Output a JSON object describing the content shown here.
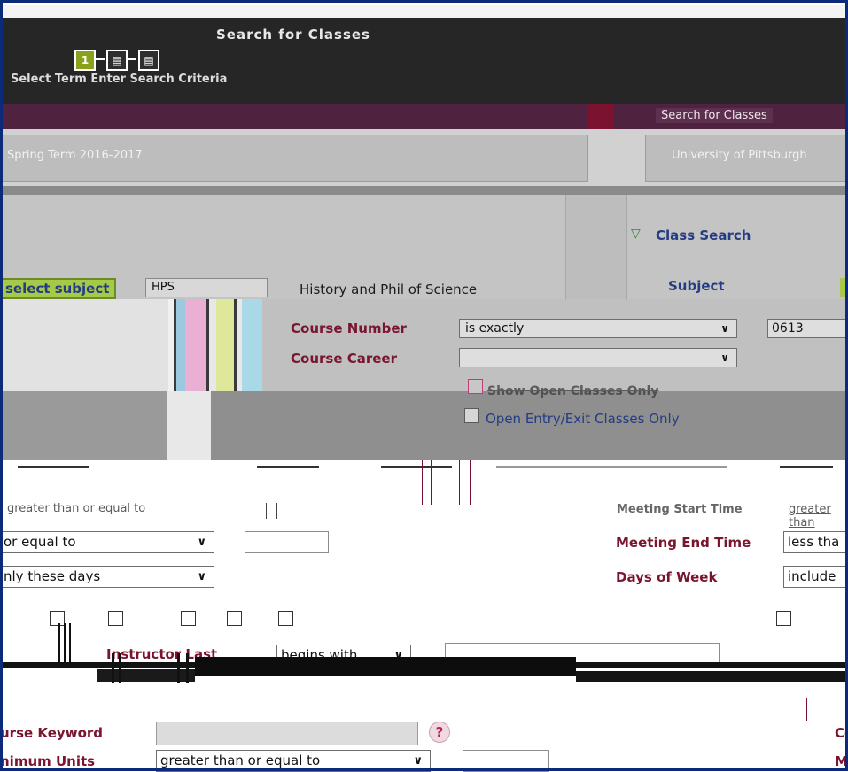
{
  "header": {
    "page_title": "Search for Classes",
    "steps": [
      "1",
      "",
      ""
    ],
    "wizard_label": "Select Term  Enter Search Criteria"
  },
  "tabs": {
    "active": "Search for Classes"
  },
  "context": {
    "term": "Spring Term 2016-2017",
    "institution": "University of Pittsburgh"
  },
  "section": {
    "title": "Class Search"
  },
  "subject": {
    "button": "select subject",
    "value": "HPS",
    "description": "History and Phil of Science",
    "label": "Subject"
  },
  "course_number": {
    "label": "Course Number",
    "operator": "is exactly",
    "value": "0613"
  },
  "course_career": {
    "label": "Course Career",
    "value": ""
  },
  "checkboxes": {
    "open_only": "Show Open Classes Only",
    "open_entry": "Open Entry/Exit Classes Only"
  },
  "meeting": {
    "start_operator": "greater than or equal to",
    "start_label": "Meeting Start Time",
    "start_right_op": "greater than",
    "end_row_left_op": "or equal to",
    "end_label": "Meeting End Time",
    "end_operator": "less tha",
    "days_left_op": "nly these days",
    "days_label": "Days of Week",
    "days_operator": "include"
  },
  "instructor": {
    "label": "Instructor Last",
    "operator": "begins with"
  },
  "keyword": {
    "label": "urse Keyword",
    "right_label": "Co"
  },
  "units": {
    "label": "nimum Units",
    "operator": "greater than or equal to",
    "right_label": "M"
  },
  "colors": {
    "frame": "#0b2a78",
    "crimson_label": "#7a1530",
    "blue_label": "#233c82",
    "accent_green": "#a7c94a"
  }
}
